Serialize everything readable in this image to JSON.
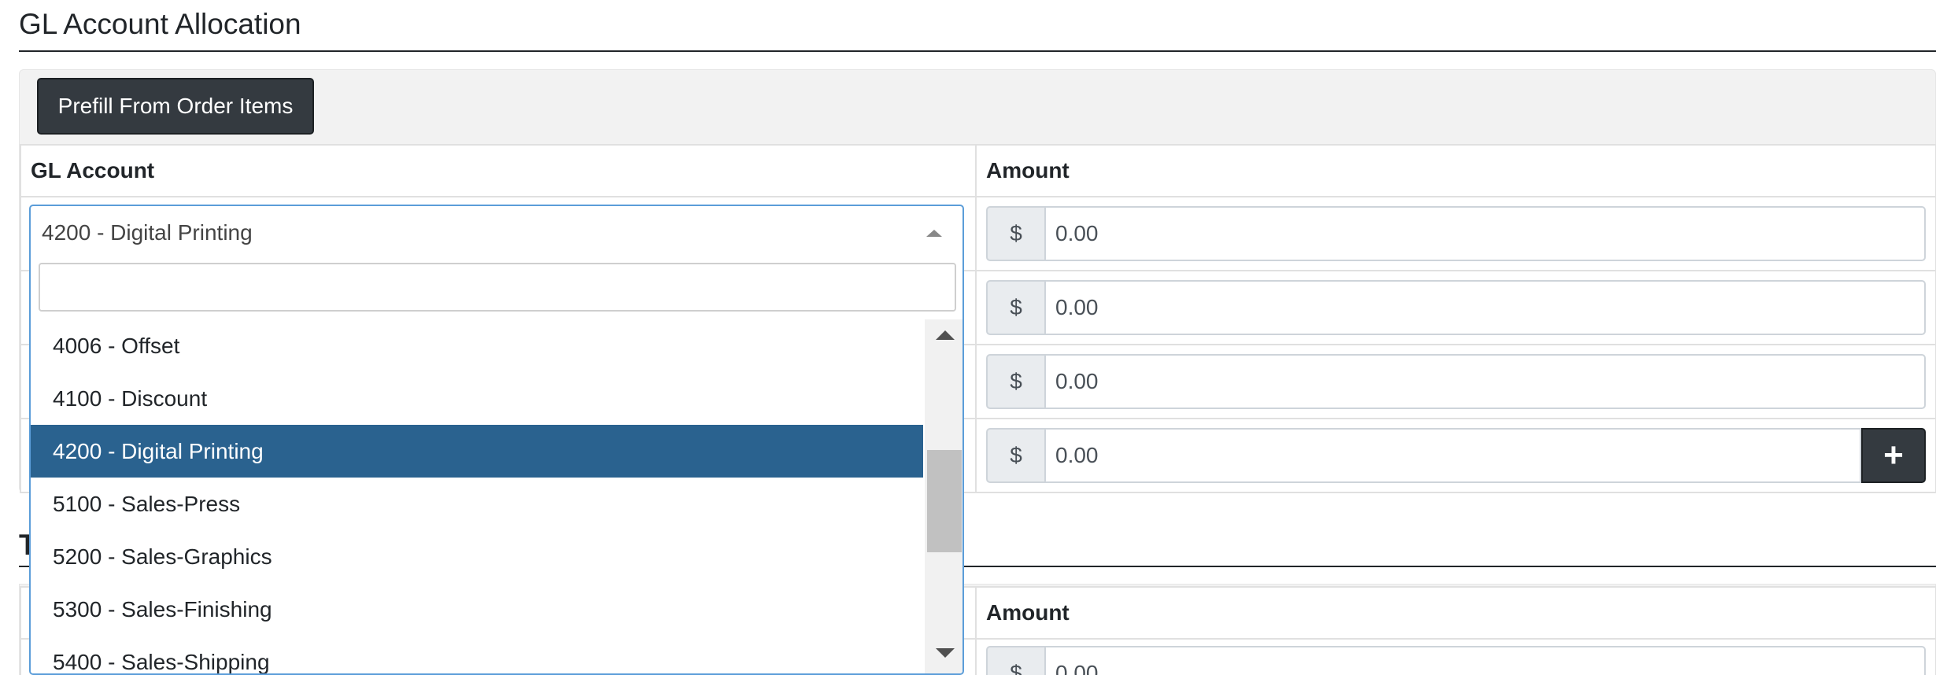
{
  "gl_section": {
    "title": "GL Account Allocation",
    "prefill_label": "Prefill From Order Items",
    "col_account": "GL Account",
    "col_amount": "Amount",
    "currency_symbol": "$",
    "rows": [
      {
        "amount": "0.00"
      },
      {
        "amount": "0.00"
      },
      {
        "amount": "0.00"
      },
      {
        "amount": "0.00"
      }
    ],
    "add_icon": "plus-icon"
  },
  "select": {
    "selected_value": "4200 - Digital Printing",
    "search_value": "",
    "options": [
      "4006 - Offset",
      "4100 - Discount",
      "4200 - Digital Printing",
      "5100 - Sales-Press",
      "5200 - Sales-Graphics",
      "5300 - Sales-Finishing",
      "5400 - Sales-Shipping"
    ],
    "highlighted_index": 2
  },
  "second_section": {
    "title_partial": "T",
    "col_amount": "Amount",
    "currency_symbol": "$",
    "amount": "0.00"
  },
  "colors": {
    "dark_button": "#343a40",
    "selected_option": "#2a628f",
    "focus_border": "#5b9dd9"
  }
}
